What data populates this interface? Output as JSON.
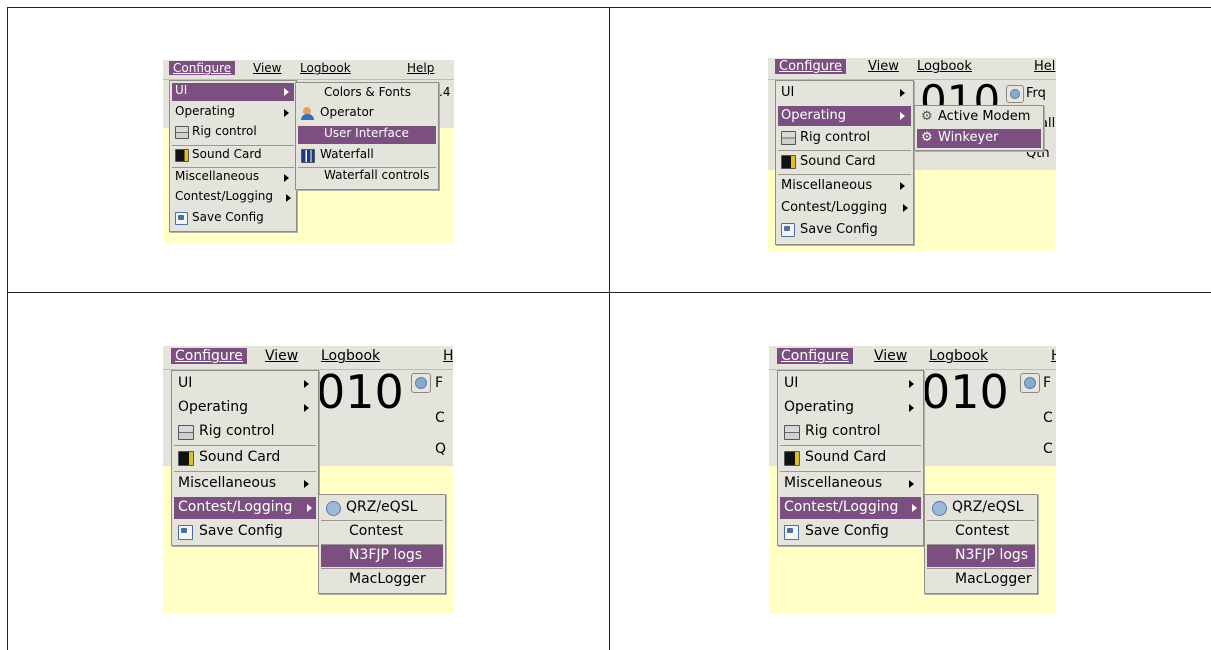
{
  "panels": [
    {
      "menubar": {
        "configure": "Configure",
        "view": "View",
        "logbook": "Logbook",
        "help": "Help",
        "freq_fragment": ".4"
      },
      "main_menu": [
        "UI",
        "Operating",
        "Rig control",
        "Sound Card",
        "Miscellaneous",
        "Contest/Logging",
        "Save Config"
      ],
      "submenu": [
        "Colors & Fonts",
        "Operator",
        "User Interface",
        "Waterfall",
        "Waterfall controls"
      ]
    },
    {
      "menubar": {
        "configure": "Configure",
        "view": "View",
        "logbook": "Logbook",
        "help": "Hel",
        "freq_fragment": "010",
        "side_labels": [
          "Frq",
          "all",
          "Qth"
        ]
      },
      "main_menu": [
        "UI",
        "Operating",
        "Rig control",
        "Sound Card",
        "Miscellaneous",
        "Contest/Logging",
        "Save Config"
      ],
      "submenu": [
        "Active Modem",
        "Winkeyer"
      ]
    },
    {
      "menubar": {
        "configure": "Configure",
        "view": "View",
        "logbook": "Logbook",
        "help": "H",
        "freq_fragment": "010",
        "side_labels": [
          "F",
          "C",
          "Q"
        ]
      },
      "main_menu": [
        "UI",
        "Operating",
        "Rig control",
        "Sound Card",
        "Miscellaneous",
        "Contest/Logging",
        "Save Config"
      ],
      "submenu": [
        "QRZ/eQSL",
        "Contest",
        "N3FJP logs",
        "MacLogger"
      ]
    },
    {
      "menubar": {
        "configure": "Configure",
        "view": "View",
        "logbook": "Logbook",
        "help": "H",
        "freq_fragment": "010",
        "side_labels": [
          "F",
          "C",
          "C"
        ]
      },
      "main_menu": [
        "UI",
        "Operating",
        "Rig control",
        "Sound Card",
        "Miscellaneous",
        "Contest/Logging",
        "Save Config"
      ],
      "submenu": [
        "QRZ/eQSL",
        "Contest",
        "N3FJP logs",
        "MacLogger"
      ]
    }
  ],
  "colors": {
    "selection": "#7b4f7f",
    "menu_bg": "#e4e3dc",
    "window_bg": "#ffffc6"
  },
  "icons": {
    "rig": "rig-control-icon",
    "sound": "sound-card-icon",
    "save": "save-config-icon",
    "operator": "operator-icon",
    "waterfall": "waterfall-icon",
    "globe": "globe-icon",
    "gear": "gear-icon"
  }
}
